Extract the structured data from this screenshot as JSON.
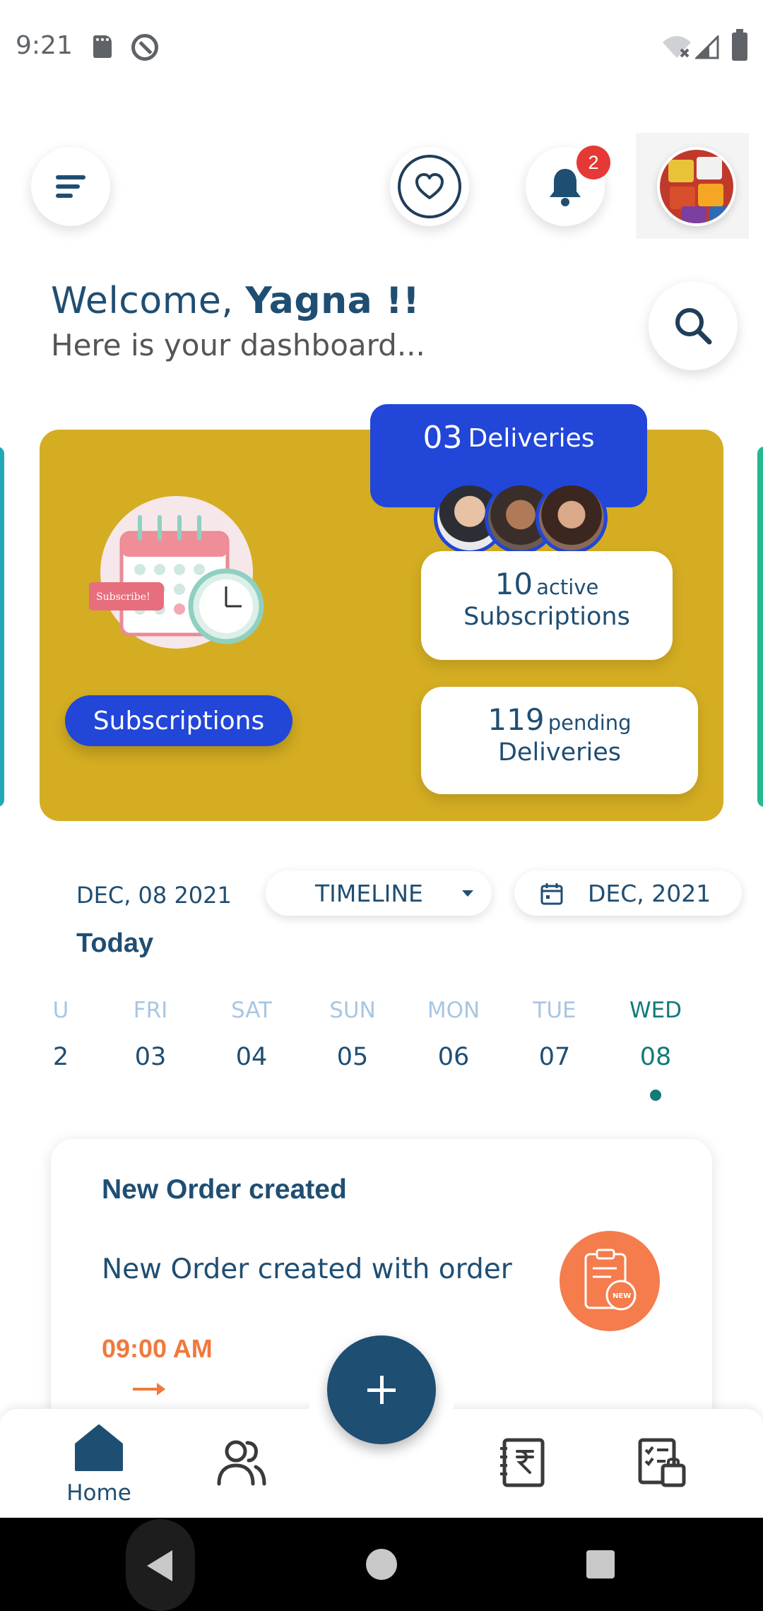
{
  "status_bar": {
    "time": "9:21"
  },
  "header": {
    "notification_count": "2",
    "icons": [
      "menu-icon",
      "heart-icon",
      "bell-icon",
      "search-icon"
    ]
  },
  "welcome": {
    "greeting": "Welcome, ",
    "name": "Yagna !!",
    "subtitle": "Here is your dashboard..."
  },
  "dashboard_card": {
    "subscriptions_button": "Subscriptions",
    "deliveries_count": "03",
    "deliveries_label": "Deliveries",
    "active_count": "10",
    "active_small": "active",
    "active_label": "Subscriptions",
    "pending_count": "119",
    "pending_small": "pending",
    "pending_label": "Deliveries",
    "illustration_text": "Subscribe!",
    "colors": {
      "card": "#d4ad22",
      "primary_blue": "#2146d8",
      "left_peek": "#23a8b8",
      "right_peek": "#23b88f"
    }
  },
  "timeline": {
    "current_date": "DEC, 08 2021",
    "view_selector": "TIMELINE",
    "month_selector": "DEC, 2021",
    "today_label": "Today",
    "days": [
      {
        "name": "U",
        "date": "2"
      },
      {
        "name": "FRI",
        "date": "03"
      },
      {
        "name": "SAT",
        "date": "04"
      },
      {
        "name": "SUN",
        "date": "05"
      },
      {
        "name": "MON",
        "date": "06"
      },
      {
        "name": "TUE",
        "date": "07"
      },
      {
        "name": "WED",
        "date": "08"
      }
    ],
    "selected_day": "WED 08"
  },
  "notification": {
    "title": "New Order created",
    "description": "New Order created with order",
    "time": "09:00 AM",
    "badge_text": "NEW"
  },
  "bottom_nav": {
    "home_label": "Home",
    "items": [
      "home-icon",
      "users-icon",
      "rupee-ledger-icon",
      "checklist-icon"
    ]
  },
  "colors": {
    "primary_text": "#1f4e73",
    "accent_orange": "#f0793c",
    "active_teal": "#137a7a",
    "badge_red": "#e53935"
  }
}
